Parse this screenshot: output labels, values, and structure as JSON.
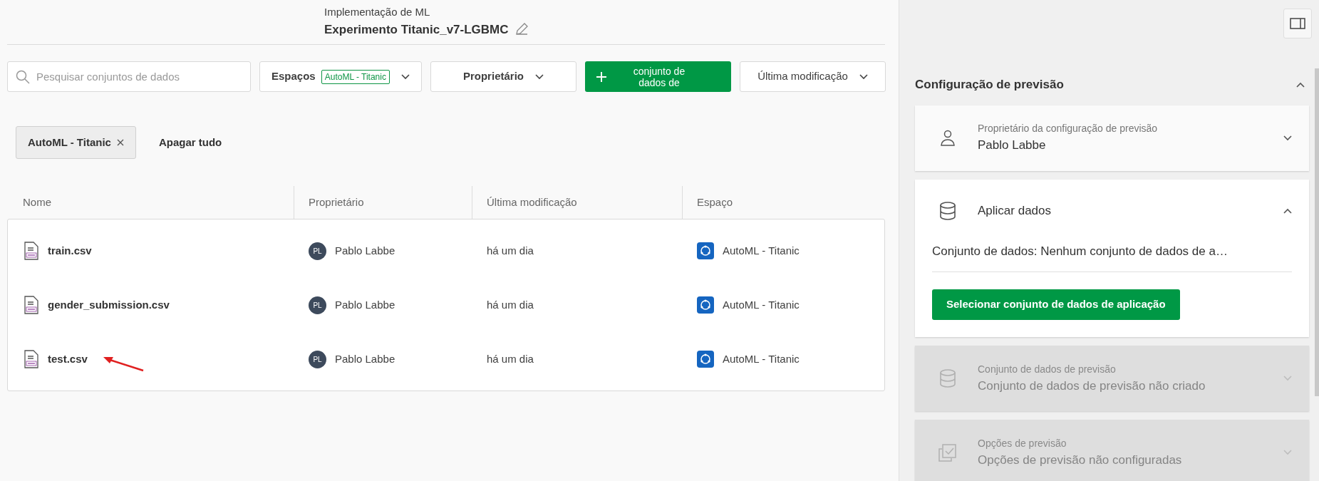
{
  "header": {
    "subtitle": "Implementação de ML",
    "title": "Experimento Titanic_v7-LGBMC"
  },
  "search": {
    "placeholder": "Pesquisar conjuntos de dados"
  },
  "filters": [
    {
      "kind": "dropdown",
      "label": "Espaços",
      "tag": "AutoML - Titanic"
    },
    {
      "kind": "dropdown",
      "label": "Proprietário"
    },
    {
      "kind": "add",
      "label": "conjunto de dados de"
    },
    {
      "kind": "dropdown",
      "label": "Última modificação"
    }
  ],
  "chips": [
    {
      "label": "AutoML - Titanic"
    }
  ],
  "clear_all": "Apagar tudo",
  "table": {
    "columns": [
      "Nome",
      "Proprietário",
      "Última modificação",
      "Espaço"
    ],
    "rows": [
      {
        "name": "train.csv",
        "initials": "PL",
        "owner": "Pablo Labbe",
        "modified": "há um dia",
        "space": "AutoML - Titanic",
        "arrow": false
      },
      {
        "name": "gender_submission.csv",
        "initials": "PL",
        "owner": "Pablo Labbe",
        "modified": "há um dia",
        "space": "AutoML - Titanic",
        "arrow": false
      },
      {
        "name": "test.csv",
        "initials": "PL",
        "owner": "Pablo Labbe",
        "modified": "há um dia",
        "space": "AutoML - Titanic",
        "arrow": true
      }
    ]
  },
  "panel": {
    "title": "Configuração de previsão",
    "expanded": true,
    "sections": [
      {
        "kind": "owner",
        "label": "Proprietário da configuração de previsão",
        "value": "Pablo Labbe",
        "expanded": false,
        "disabled": false
      },
      {
        "kind": "apply",
        "label": "Aplicar dados",
        "expanded": true,
        "disabled": false,
        "text": "Conjunto de dados: Nenhum conjunto de dados de a…",
        "button": "Selecionar conjunto de dados de aplicação"
      },
      {
        "kind": "dataset",
        "label": "Conjunto de dados de previsão",
        "value": "Conjunto de dados de previsão não criado",
        "expanded": false,
        "disabled": true
      },
      {
        "kind": "options",
        "label": "Opções de previsão",
        "value": "Opções de previsão não configuradas",
        "expanded": false,
        "disabled": true
      }
    ]
  }
}
